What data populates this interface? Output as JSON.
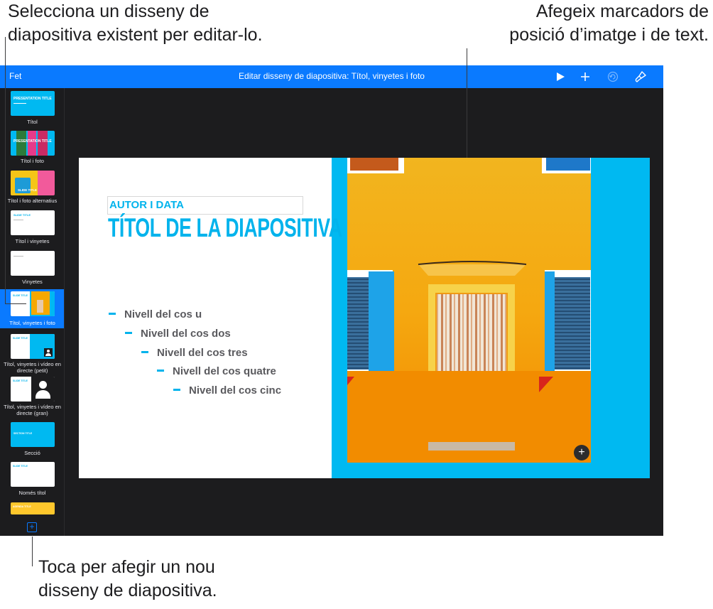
{
  "callouts": {
    "top_left": [
      "Selecciona un disseny de",
      "diapositiva existent per editar-lo."
    ],
    "top_right": [
      "Afegeix marcadors de",
      "posició d’imatge i de text."
    ],
    "bottom_left": [
      "Toca per afegir un nou",
      "disseny de diapositiva."
    ]
  },
  "toolbar": {
    "done_label": "Fet",
    "title": "Editar disseny de diapositiva: Títol, vinyetes i foto",
    "icons": [
      "play-icon",
      "plus-icon",
      "undo-icon",
      "paintbrush-icon"
    ]
  },
  "sidebar": {
    "layouts": [
      {
        "label": "Títol",
        "thumb_text": "PRESENTATION TITLE"
      },
      {
        "label": "Títol i foto",
        "thumb_text": "PRESENTATION TITLE"
      },
      {
        "label": "Títol i foto alternatius",
        "thumb_text": "SLIDE TITLE"
      },
      {
        "label": "Títol i vinyetes",
        "thumb_text": "SLIDE TITLE"
      },
      {
        "label": "Vinyetes",
        "thumb_text": ""
      },
      {
        "label": "Títol, vinyetes i foto",
        "thumb_text": "SLIDE TITLE",
        "selected": true
      },
      {
        "label": "Títol, vinyetes i vídeo en directe (petit)",
        "thumb_text": "SLIDE TITLE"
      },
      {
        "label": "Títol, vinyetes i vídeo en directe (gran)",
        "thumb_text": "SLIDE TITLE"
      },
      {
        "label": "Secció",
        "thumb_text": "SECTION TITLE"
      },
      {
        "label": "Només títol",
        "thumb_text": "SLIDE TITLE"
      },
      {
        "label": "",
        "thumb_text": "AGENDA TITLE"
      }
    ],
    "add_label": "+"
  },
  "slide": {
    "author": "AUTOR I DATA",
    "title": "TÍTOL DE LA DIAPOSITIVA",
    "bullets": [
      "Nivell del cos u",
      "Nivell del cos dos",
      "Nivell del cos tres",
      "Nivell del cos quatre",
      "Nivell del cos cinc"
    ],
    "media_add_label": "+"
  },
  "colors": {
    "accent": "#0a7aff",
    "slide_blue": "#00b9f1",
    "wall_yellow": "#f5a800",
    "shutter_blue": "#1ea3e8"
  }
}
